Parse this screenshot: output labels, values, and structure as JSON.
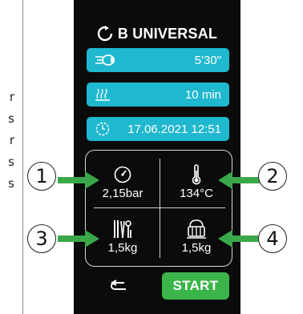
{
  "title": "B UNIVERSAL",
  "bars": [
    {
      "icon": "steam-icon",
      "value": "5'30\""
    },
    {
      "icon": "heating-icon",
      "value": "10 min"
    },
    {
      "icon": "clock-icon",
      "value": "17.06.2021   12:51"
    }
  ],
  "cells": [
    {
      "icon": "pressure-gauge-icon",
      "value": "2,15bar"
    },
    {
      "icon": "thermometer-icon",
      "value": "134°C"
    },
    {
      "icon": "instruments-icon",
      "value": "1,5kg"
    },
    {
      "icon": "textile-pack-icon",
      "value": "1,5kg"
    }
  ],
  "start_label": "START",
  "callouts": [
    "1",
    "2",
    "3",
    "4"
  ],
  "edge_text": [
    "r",
    "s",
    "r",
    "s",
    "s"
  ],
  "colors": {
    "bar": "#1fb8cf",
    "start": "#3bb54a",
    "arrow": "#3aa84a",
    "screen": "#0b0b0b"
  }
}
